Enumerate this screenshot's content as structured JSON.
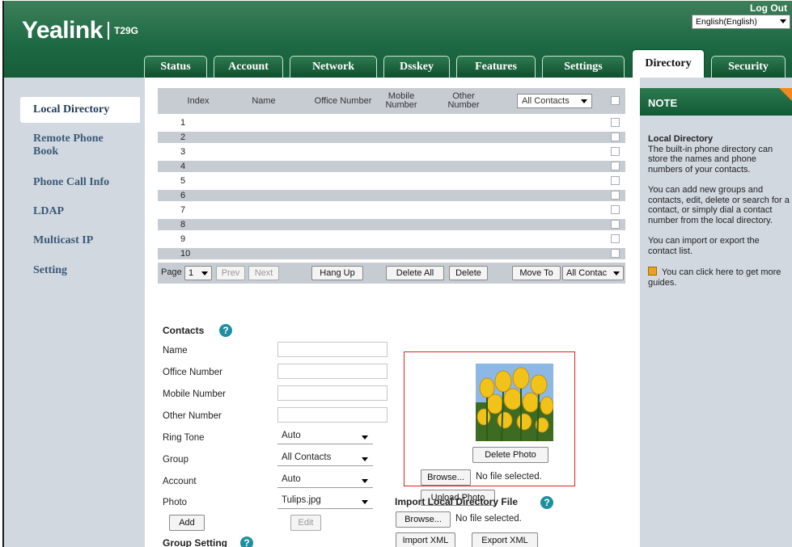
{
  "header": {
    "brand": "Yealink",
    "model": "T29G",
    "logout_label": "Log Out",
    "language": "English(English)"
  },
  "tabs": [
    {
      "label": "Status"
    },
    {
      "label": "Account"
    },
    {
      "label": "Network"
    },
    {
      "label": "Dsskey"
    },
    {
      "label": "Features"
    },
    {
      "label": "Settings"
    },
    {
      "label": "Directory",
      "active": true
    },
    {
      "label": "Security"
    }
  ],
  "sidebar": {
    "items": [
      {
        "label": "Local Directory",
        "active": true
      },
      {
        "label": "Remote Phone Book"
      },
      {
        "label": "Phone Call Info"
      },
      {
        "label": "LDAP"
      },
      {
        "label": "Multicast IP"
      },
      {
        "label": "Setting"
      }
    ]
  },
  "table": {
    "columns": [
      "Index",
      "Name",
      "Office Number",
      "Mobile Number",
      "Other Number"
    ],
    "group_filter": "All Contacts",
    "rows": [
      "1",
      "2",
      "3",
      "4",
      "5",
      "6",
      "7",
      "8",
      "9",
      "10"
    ]
  },
  "pager": {
    "page_label": "Page",
    "page_value": "1",
    "prev_label": "Prev",
    "next_label": "Next",
    "hangup_label": "Hang Up",
    "delete_all_label": "Delete All",
    "delete_label": "Delete",
    "move_to_label": "Move To",
    "move_target": "All Contac"
  },
  "contacts": {
    "title": "Contacts",
    "fields": {
      "name": "Name",
      "office": "Office Number",
      "mobile": "Mobile Number",
      "other": "Other Number",
      "ring_tone": "Ring Tone",
      "group": "Group",
      "account": "Account",
      "photo": "Photo"
    },
    "values": {
      "ring_tone": "Auto",
      "group": "All Contacts",
      "account": "Auto",
      "photo": "Tulips.jpg"
    },
    "add_label": "Add",
    "edit_label": "Edit",
    "delete_photo_label": "Delete Photo",
    "browse_label": "Browse...",
    "no_file": "No file selected.",
    "upload_photo_label": "Upload Photo"
  },
  "import": {
    "title": "Import Local Directory File",
    "browse_label": "Browse...",
    "no_file": "No file selected.",
    "import_xml_label": "Import XML",
    "export_xml_label": "Export XML"
  },
  "group_setting": {
    "title": "Group Setting"
  },
  "note": {
    "title": "NOTE",
    "heading": "Local Directory",
    "p1": "The built-in phone directory can store the names and phone numbers of your contacts.",
    "p2": "You can add new groups and contacts, edit, delete or search for a contact, or simply dial a contact number from the local directory.",
    "p3": "You can import or export the contact list.",
    "p4": "You can click here to get more guides."
  },
  "colors": {
    "header_green": "#1d6a44",
    "sidebar_bg": "#d2d8e0",
    "row_alt": "#c7ccd3",
    "photo_highlight": "#e02020",
    "help_icon": "#1f8fa0"
  }
}
